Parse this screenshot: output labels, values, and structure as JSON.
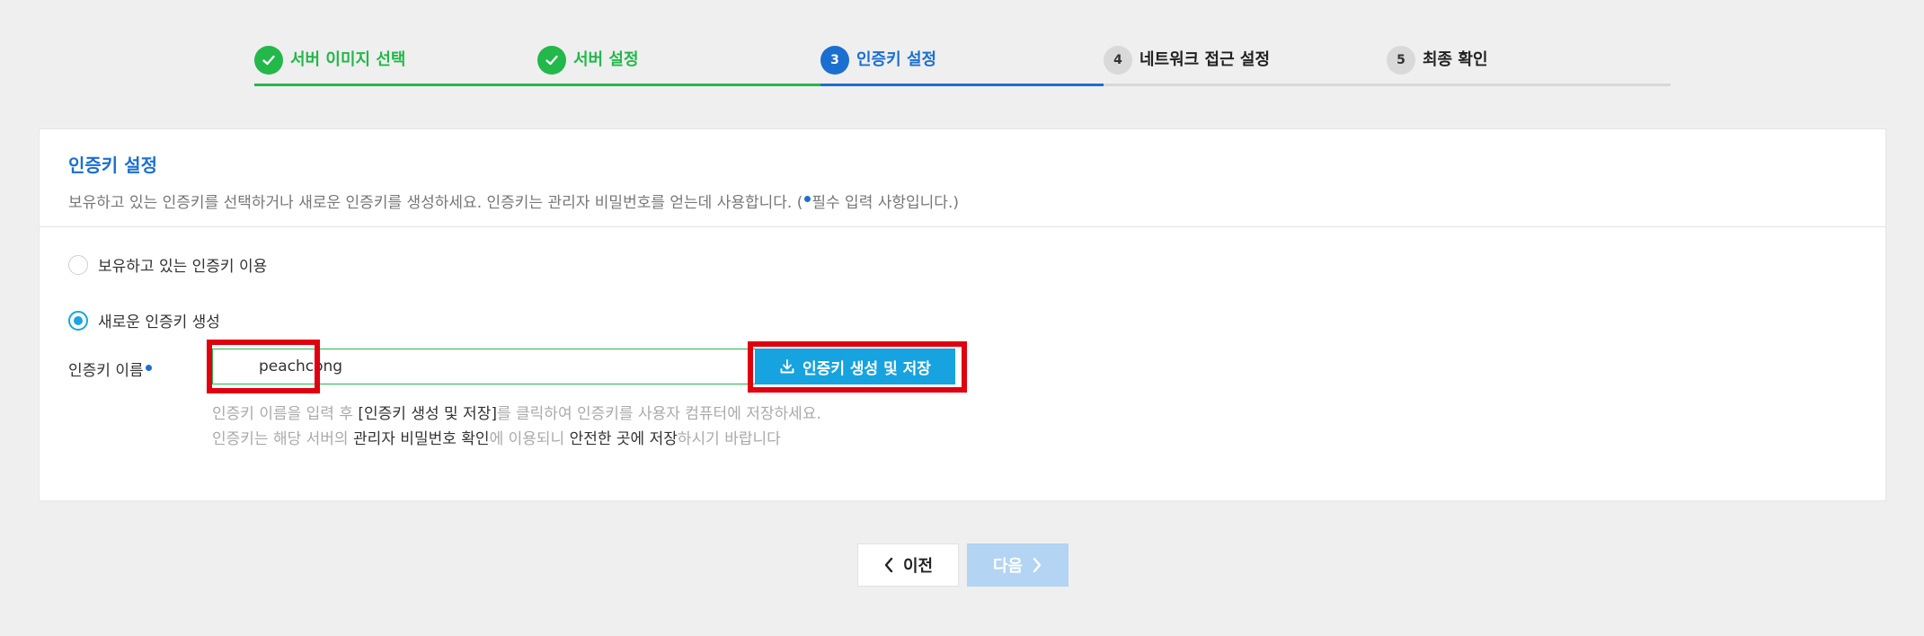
{
  "stepper": {
    "steps": [
      {
        "number": "",
        "label": "서버 이미지 선택",
        "state": "done",
        "icon": "check-icon"
      },
      {
        "number": "",
        "label": "서버 설정",
        "state": "done",
        "icon": "check-icon"
      },
      {
        "number": "3",
        "label": "인증키 설정",
        "state": "active"
      },
      {
        "number": "4",
        "label": "네트워크 접근 설정",
        "state": "pending"
      },
      {
        "number": "5",
        "label": "최종 확인",
        "state": "pending"
      }
    ]
  },
  "section": {
    "title": "인증키 설정",
    "description_before": "보유하고 있는 인증키를 선택하거나 새로운 인증키를 생성하세요. 인증키는 관리자 비밀번호를 얻는데 사용합니다. (",
    "description_after": "필수 입력 사항입니다.)"
  },
  "options": {
    "existing_label": "보유하고 있는 인증키 이용",
    "new_label": "새로운 인증키 생성",
    "selected": "new"
  },
  "key_field": {
    "label": "인증키 이름",
    "value": "peachcong"
  },
  "generate_button": {
    "label": "인증키 생성 및 저장",
    "icon": "download-icon"
  },
  "help": {
    "line1_part1": "인증키 이름을 입력 후 ",
    "line1_part2": "[인증키 생성 및 저장]",
    "line1_part3": "를 클릭하여 인증키를 사용자 컴퓨터에 저장하세요.",
    "line2_part1": "인증키는 해당 서버의 ",
    "line2_part2": "관리자 비밀번호 확인",
    "line2_part3": "에 이용되니 ",
    "line2_part4": "안전한 곳에 저장",
    "line2_part5": "하시기 바랍니다"
  },
  "nav": {
    "prev_label": "이전",
    "next_label": "다음"
  },
  "colors": {
    "done": "#22b84a",
    "active": "#1b6fd1",
    "button": "#17a2e0",
    "highlight": "#e0000f",
    "next_disabled": "#b3d4f2"
  }
}
